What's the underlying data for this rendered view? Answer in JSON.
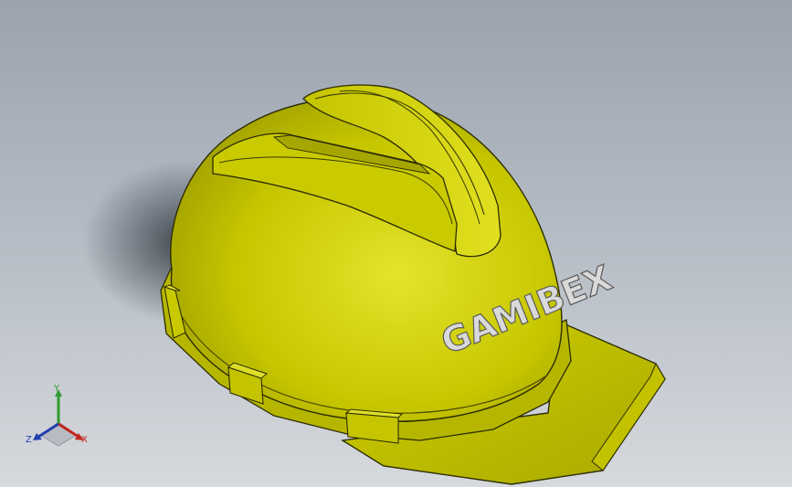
{
  "viewport": {
    "background_top": "#9aa3ae",
    "background_bottom": "#d6d9dd"
  },
  "model": {
    "helmet_color": "#c8c800",
    "helmet_highlight": "#e6e62a",
    "helmet_shadow": "#8c8c00",
    "logo_text": "GAMIBEX"
  },
  "triad": {
    "x_label": "X",
    "y_label": "Y",
    "z_label": "Z",
    "x_color": "#c0281f",
    "y_color": "#2f9a2f",
    "z_color": "#2440b0"
  }
}
